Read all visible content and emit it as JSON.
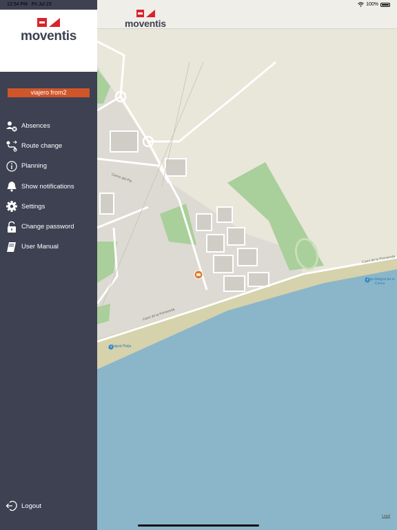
{
  "status_bar": {
    "time": "12:54 PM",
    "date": "Fri Jul 23",
    "battery": "100%"
  },
  "brand": {
    "name": "moventis",
    "accent": "#d9242b"
  },
  "user": {
    "badge": "viajero from2"
  },
  "menu": [
    {
      "label": "Absences",
      "icon": "absences-icon"
    },
    {
      "label": "Route change",
      "icon": "route-change-icon"
    },
    {
      "label": "Planning",
      "icon": "info-icon"
    },
    {
      "label": "Show notifications",
      "icon": "bell-icon"
    },
    {
      "label": "Settings",
      "icon": "gear-icon"
    },
    {
      "label": "Change password",
      "icon": "unlock-icon"
    },
    {
      "label": "User Manual",
      "icon": "book-icon"
    }
  ],
  "logout": {
    "label": "Logout"
  },
  "map": {
    "road_labels": [
      "Camí de la Pomareda",
      "Camí de la Pomareda",
      "Carrer del Pla"
    ],
    "poi_labels": [
      "Platja Malgrat de la Conca",
      "Malgrat Platja"
    ],
    "legal": "Legal"
  },
  "colors": {
    "sidebar": "#3d4152",
    "badge": "#d0562a",
    "sea": "#8bb6c9",
    "land": "#e9e6da",
    "green": "#a9cf9a"
  }
}
